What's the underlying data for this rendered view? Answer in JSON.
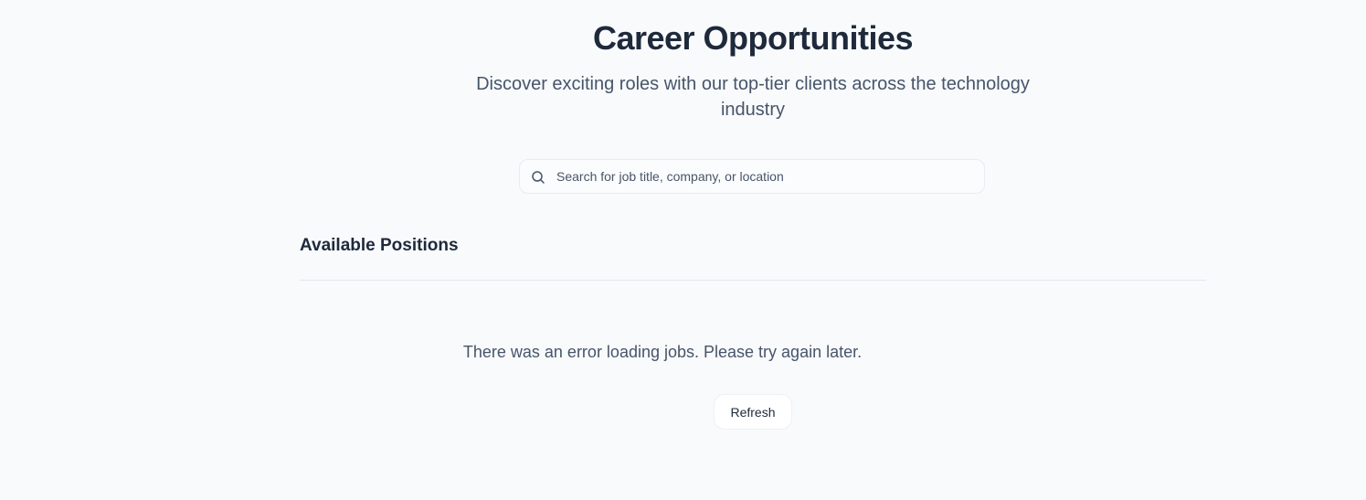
{
  "header": {
    "title": "Career Opportunities",
    "subtitle": "Discover exciting roles with our top-tier clients across the technology industry"
  },
  "search": {
    "placeholder": "Search for job title, company, or location",
    "value": "",
    "icon": "search-icon"
  },
  "positions": {
    "section_title": "Available Positions",
    "error_message": "There was an error loading jobs. Please try again later.",
    "refresh_label": "Refresh"
  },
  "colors": {
    "background": "#f8fafc",
    "heading": "#1e293b",
    "muted_text": "#475569",
    "divider": "#e2e8f0"
  }
}
